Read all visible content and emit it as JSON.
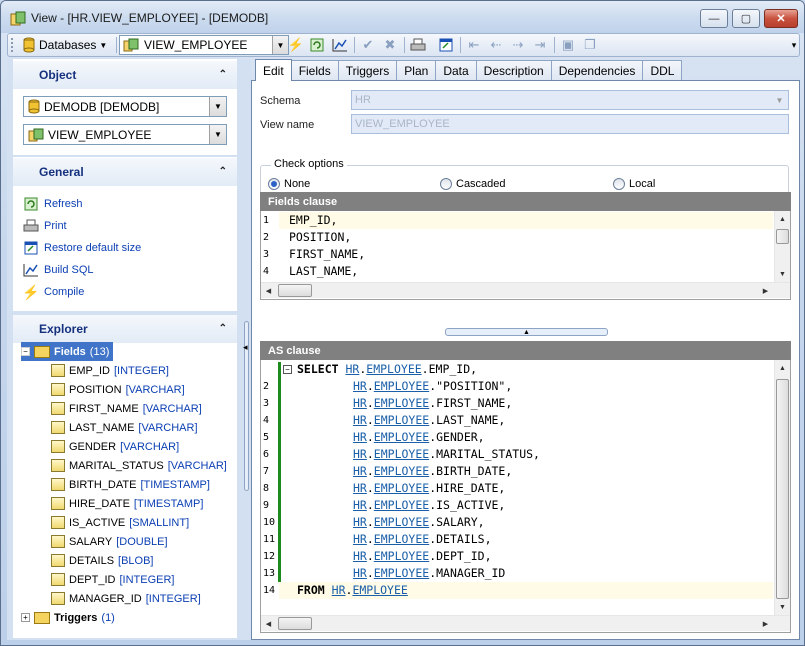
{
  "window": {
    "title": "View - [HR.VIEW_EMPLOYEE] - [DEMODB]",
    "buttons": {
      "minimize": "—",
      "maximize": "▢",
      "close": "✕"
    }
  },
  "toolbar": {
    "databases_label": "Databases",
    "object_combo_value": "VIEW_EMPLOYEE"
  },
  "left": {
    "object_header": "Object",
    "db_combo": "DEMODB [DEMODB]",
    "obj_combo": "VIEW_EMPLOYEE",
    "general_header": "General",
    "actions": [
      "Refresh",
      "Print",
      "Restore default size",
      "Build SQL",
      "Compile"
    ],
    "explorer_header": "Explorer",
    "fields_node": {
      "label": "Fields",
      "count": "(13)"
    },
    "fields": [
      {
        "name": "EMP_ID",
        "type": "[INTEGER]"
      },
      {
        "name": "POSITION",
        "type": "[VARCHAR]"
      },
      {
        "name": "FIRST_NAME",
        "type": "[VARCHAR]"
      },
      {
        "name": "LAST_NAME",
        "type": "[VARCHAR]"
      },
      {
        "name": "GENDER",
        "type": "[VARCHAR]"
      },
      {
        "name": "MARITAL_STATUS",
        "type": "[VARCHAR]"
      },
      {
        "name": "BIRTH_DATE",
        "type": "[TIMESTAMP]"
      },
      {
        "name": "HIRE_DATE",
        "type": "[TIMESTAMP]"
      },
      {
        "name": "IS_ACTIVE",
        "type": "[SMALLINT]"
      },
      {
        "name": "SALARY",
        "type": "[DOUBLE]"
      },
      {
        "name": "DETAILS",
        "type": "[BLOB]"
      },
      {
        "name": "DEPT_ID",
        "type": "[INTEGER]"
      },
      {
        "name": "MANAGER_ID",
        "type": "[INTEGER]"
      }
    ],
    "triggers_node": {
      "label": "Triggers",
      "count": "(1)"
    }
  },
  "tabs": [
    "Edit",
    "Fields",
    "Triggers",
    "Plan",
    "Data",
    "Description",
    "Dependencies",
    "DDL"
  ],
  "form": {
    "schema_label": "Schema",
    "schema_value": "HR",
    "view_name_label": "View name",
    "view_name_value": "VIEW_EMPLOYEE",
    "check_options_title": "Check options",
    "options": [
      "None",
      "Cascaded",
      "Local"
    ],
    "selected_option": "None"
  },
  "fields_clause": {
    "header": "Fields clause",
    "line_numbers": [
      "1",
      "2",
      "3",
      "4"
    ],
    "lines": [
      "EMP_ID,",
      "POSITION,",
      "FIRST_NAME,",
      "LAST_NAME,"
    ]
  },
  "as_clause": {
    "header": "AS clause",
    "line_numbers": [
      "",
      "2",
      "3",
      "4",
      "5",
      "6",
      "7",
      "8",
      "9",
      "10",
      "11",
      "12",
      "13",
      "14"
    ],
    "select_kw": "SELECT",
    "from_kw": "FROM",
    "schema": "HR",
    "table": "EMPLOYEE",
    "columns": [
      "EMP_ID,",
      "\"POSITION\",",
      "FIRST_NAME,",
      "LAST_NAME,",
      "GENDER,",
      "MARITAL_STATUS,",
      "BIRTH_DATE,",
      "HIRE_DATE,",
      "IS_ACTIVE,",
      "SALARY,",
      "DETAILS,",
      "DEPT_ID,",
      "MANAGER_ID"
    ]
  }
}
